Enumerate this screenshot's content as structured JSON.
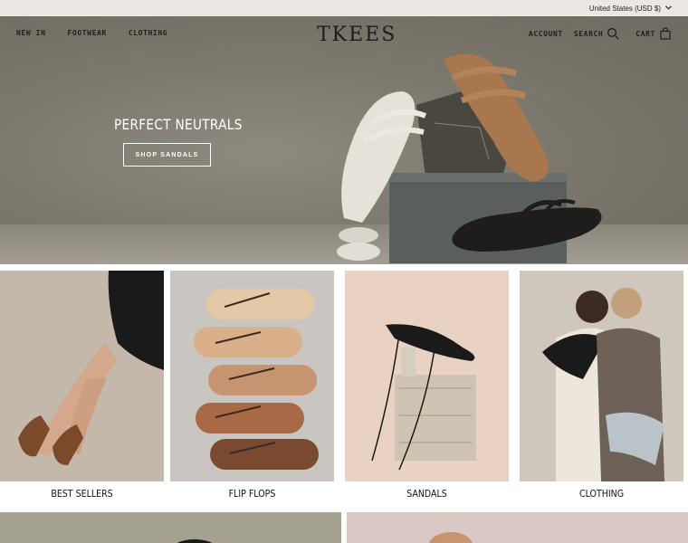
{
  "topbar": {
    "currency": "United States (USD $)"
  },
  "nav": {
    "left": [
      "NEW IN",
      "FOOTWEAR",
      "CLOTHING"
    ],
    "logo": "TKEES",
    "account": "ACCOUNT",
    "search": "SEARCH",
    "cart": "CART"
  },
  "hero": {
    "title": "PERFECT NEUTRALS",
    "button": "SHOP SANDALS"
  },
  "tiles": [
    {
      "label": "BEST SELLERS"
    },
    {
      "label": "FLIP FLOPS"
    },
    {
      "label": "SANDALS"
    },
    {
      "label": "CLOTHING"
    }
  ]
}
